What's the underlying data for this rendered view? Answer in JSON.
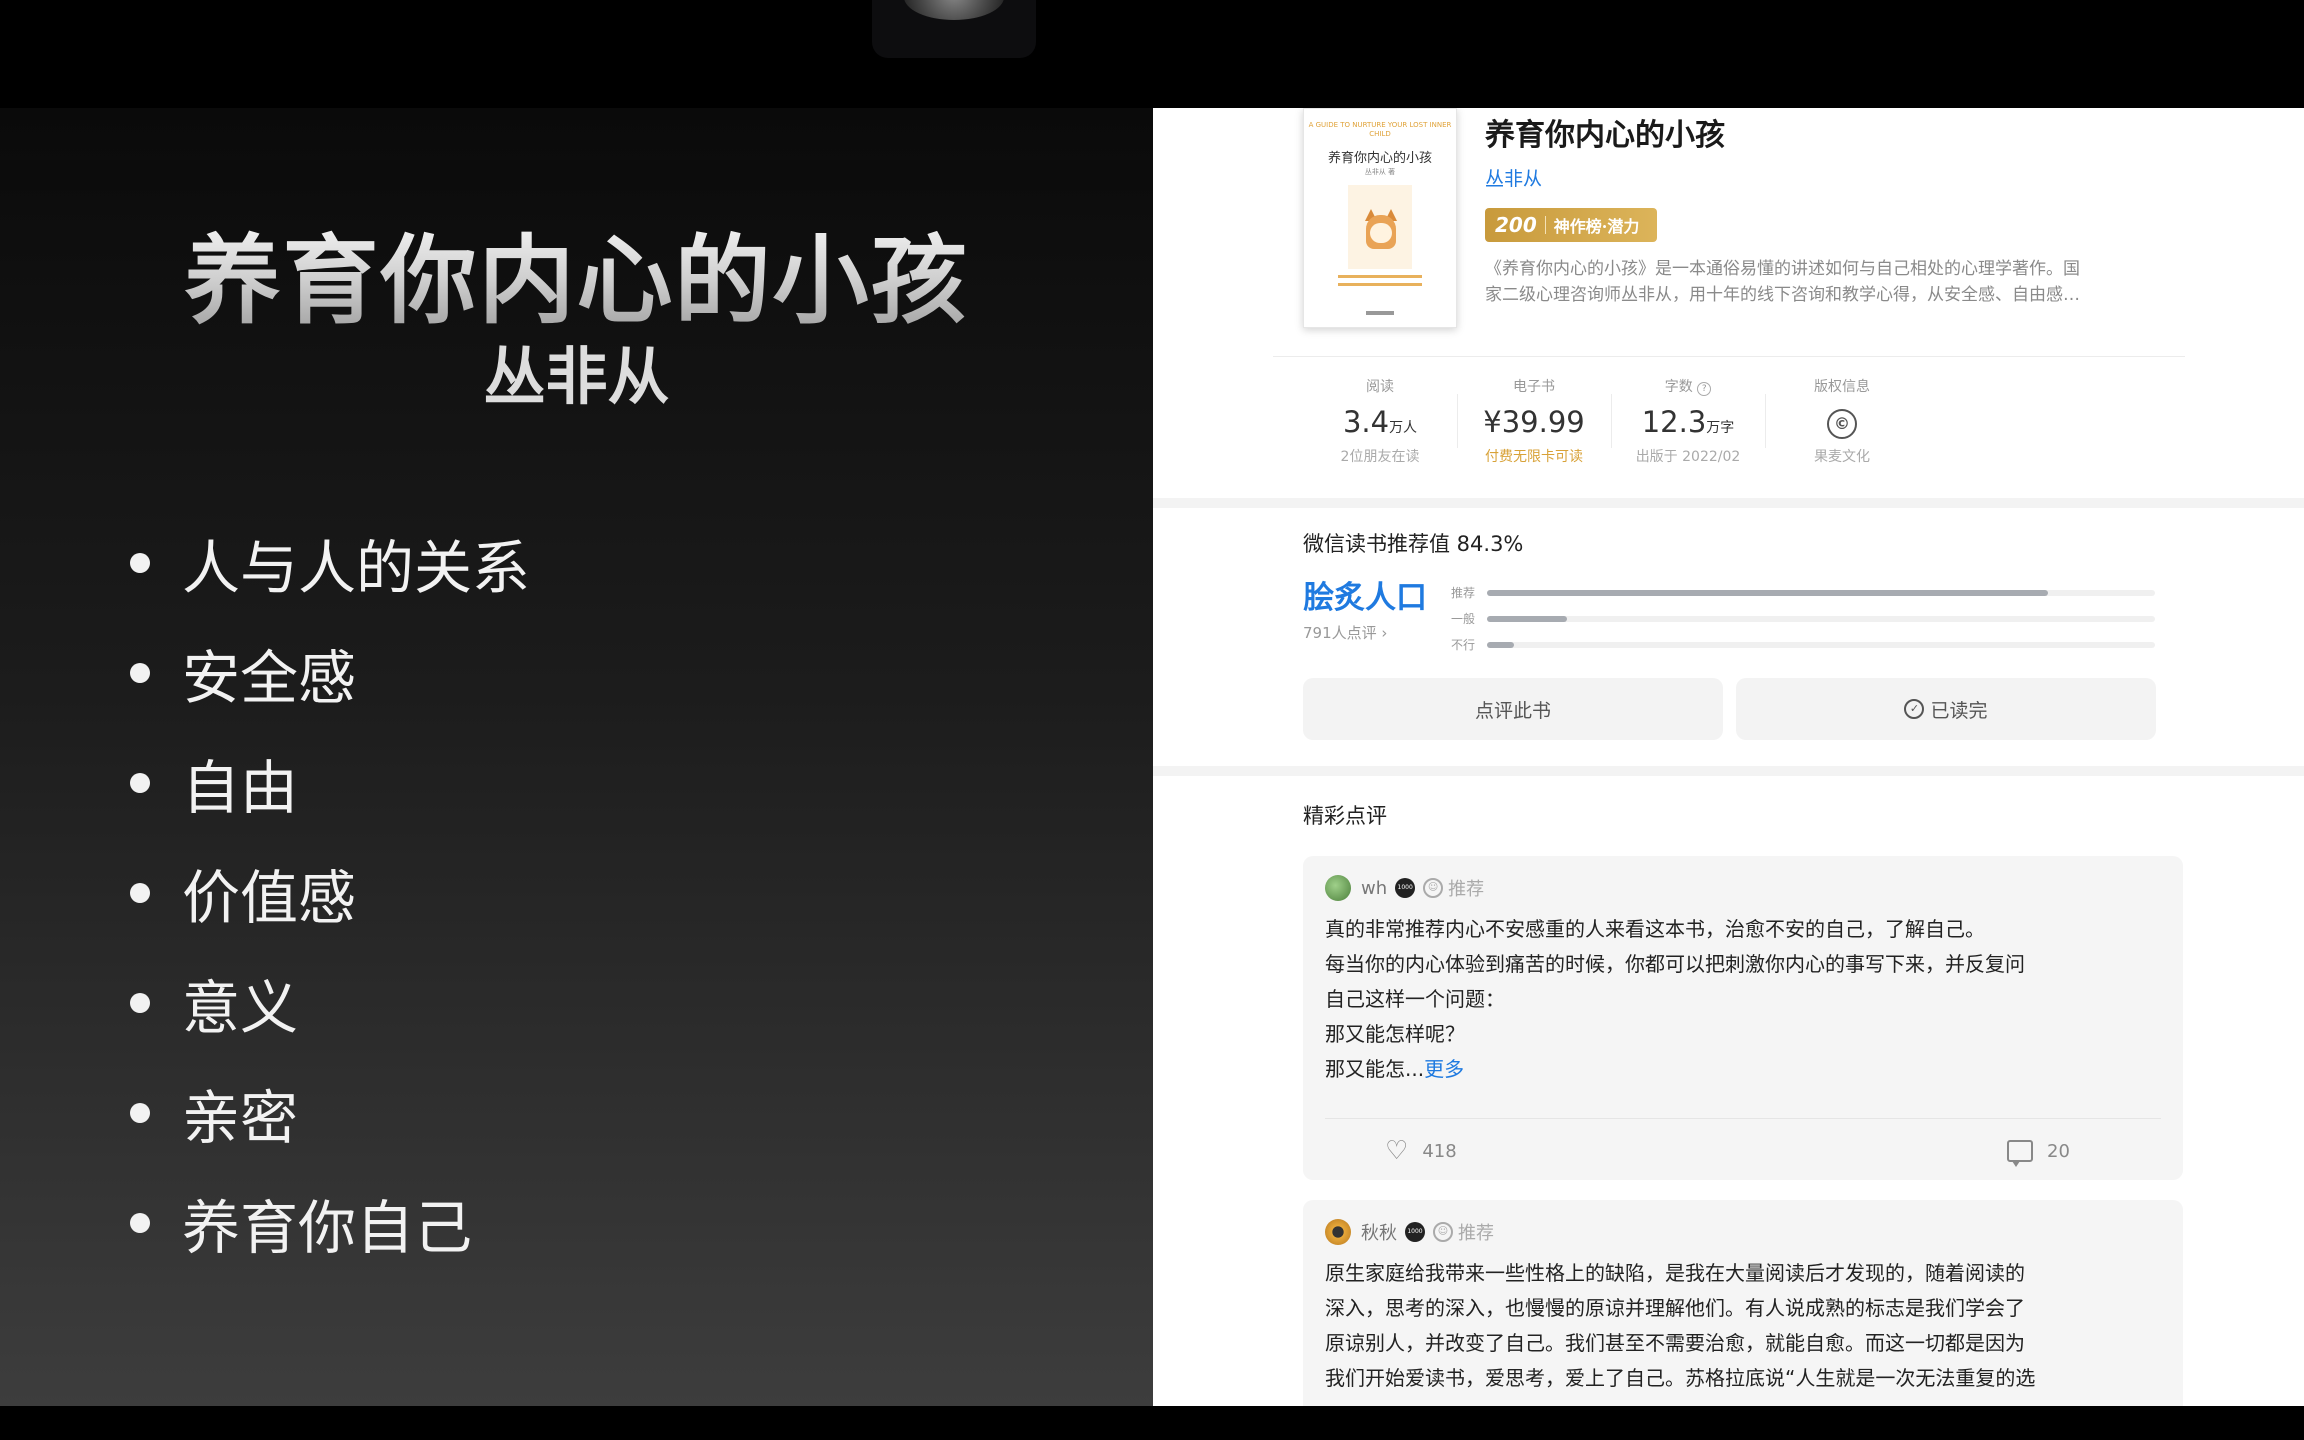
{
  "slide": {
    "title": "养育你内心的小孩",
    "author": "丛非从",
    "bullets": [
      "人与人的关系",
      "安全感",
      "自由",
      "价值感",
      "意义",
      "亲密",
      "养育你自己"
    ]
  },
  "book": {
    "cover_en": "A GUIDE TO NURTURE YOUR LOST INNER CHILD",
    "cover_title": "养育你内心的小孩",
    "cover_author": "丛非从 著",
    "title": "养育你内心的小孩",
    "author": "丛非从",
    "badge_num": "200",
    "badge_text": "神作榜·潜力",
    "description_line1": "《养育你内心的小孩》是一本通俗易懂的讲述如何与自己相处的心理学著作。国",
    "description_line2": "家二级心理咨询师丛非从，用十年的线下咨询和教学心得，从安全感、自由感…"
  },
  "stats": [
    {
      "label": "阅读",
      "value": "3.4",
      "unit": "万人",
      "sub": "2位朋友在读"
    },
    {
      "label": "电子书",
      "value": "¥39.99",
      "unit": "",
      "sub": "付费无限卡可读"
    },
    {
      "label": "字数",
      "value": "12.3",
      "unit": "万字",
      "sub": "出版于 2022/02"
    },
    {
      "label": "版权信息",
      "value": "©",
      "unit": "",
      "sub": "果麦文化"
    }
  ],
  "recommend": {
    "title": "微信读书推荐值 84.3%",
    "rating": "脍炙人口",
    "count": "791人点评 ›",
    "bars": [
      {
        "label": "推荐",
        "fraction": 0.84
      },
      {
        "label": "一般",
        "fraction": 0.12
      },
      {
        "label": "不行",
        "fraction": 0.04
      }
    ],
    "review_button": "点评此书",
    "finished_button": "已读完"
  },
  "highlights": {
    "title": "精彩点评",
    "reviews": [
      {
        "user": "wh",
        "tag": "推荐",
        "lines": [
          "真的非常推荐内心不安感重的人来看这本书，治愈不安的自己，了解自己。",
          "每当你的内心体验到痛苦的时候，你都可以把刺激你内心的事写下来，并反复问",
          "自己这样一个问题：",
          "那又能怎样呢？",
          "那又能怎..."
        ],
        "more": "更多",
        "likes": "418",
        "comments": "20"
      },
      {
        "user": "秋秋",
        "tag": "推荐",
        "lines": [
          "原生家庭给我带来一些性格上的缺陷，是我在大量阅读后才发现的，随着阅读的",
          "深入，思考的深入，也慢慢的原谅并理解他们。有人说成熟的标志是我们学会了",
          "原谅别人，并改变了自己。我们甚至不需要治愈，就能自愈。而这一切都是因为",
          "我们开始爱读书，爱思考，爱上了自己。苏格拉底说“人生就是一次无法重复的选"
        ]
      }
    ]
  },
  "colors": {
    "accent_blue": "#1f7ae0",
    "gold": "#d8a238",
    "bar_fill": "#a7abb1"
  }
}
